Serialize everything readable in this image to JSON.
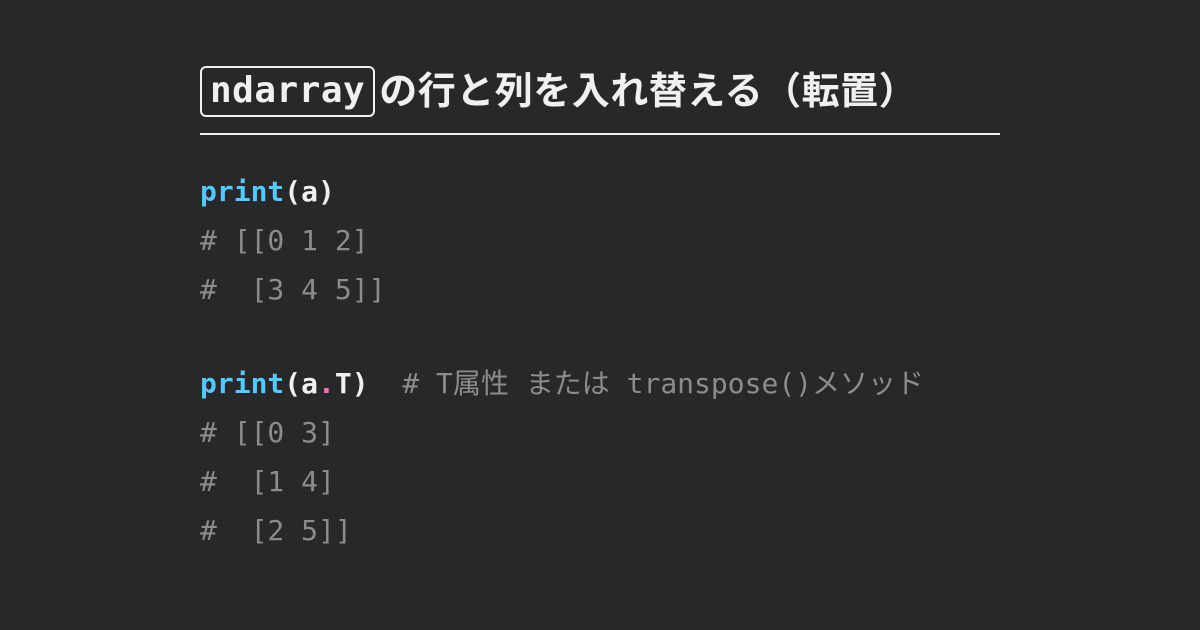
{
  "title": {
    "keyword": "ndarray",
    "rest": "の行と列を入れ替える（転置）"
  },
  "code": {
    "fn": "print",
    "lp": "(",
    "rp": ")",
    "var_a": "a",
    "dot": ".",
    "attr_T": "T",
    "spacer": "  ",
    "out1_l1": "# [[0 1 2]",
    "out1_l2": "#  [3 4 5]]",
    "cmt2": "# T属性 または transpose()メソッド",
    "out2_l1": "# [[0 3]",
    "out2_l2": "#  [1 4]",
    "out2_l3": "#  [2 5]]"
  }
}
